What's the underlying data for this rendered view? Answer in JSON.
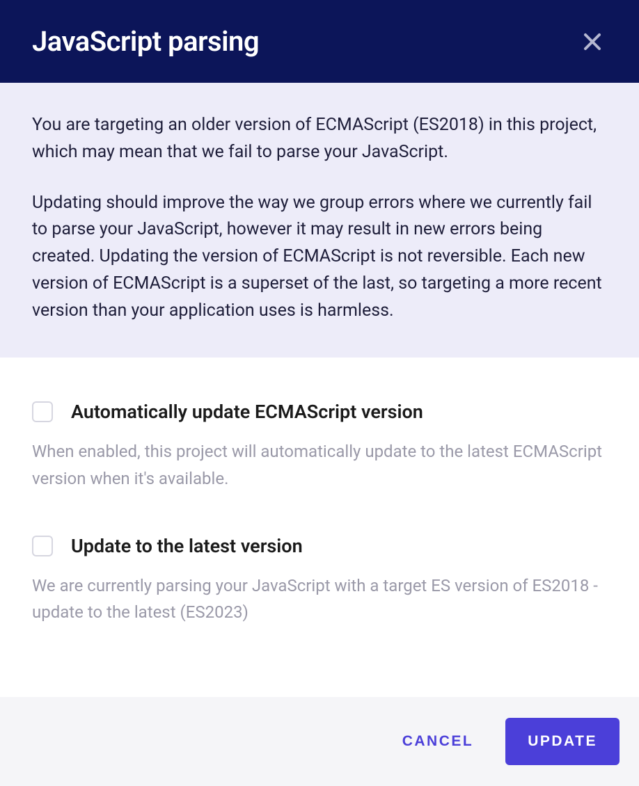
{
  "header": {
    "title": "JavaScript parsing"
  },
  "intro": {
    "p1": "You are targeting an older version of ECMAScript (ES2018) in this project, which may mean that we fail to parse your JavaScript.",
    "p2": "Updating should improve the way we group errors where we currently fail to parse your JavaScript, however it may result in new errors being created. Updating the version of ECMAScript is not reversible. Each new version of ECMAScript is a superset of the last, so targeting a more recent version than your application uses is harmless."
  },
  "options": {
    "auto": {
      "label": "Automatically update ECMAScript version",
      "desc": "When enabled, this project will automatically update to the latest ECMAScript version when it's available."
    },
    "latest": {
      "label": "Update to the latest version",
      "desc": "We are currently parsing your JavaScript with a target ES version of ES2018 - update to the latest (ES2023)"
    }
  },
  "footer": {
    "cancel": "CANCEL",
    "update": "UPDATE"
  }
}
